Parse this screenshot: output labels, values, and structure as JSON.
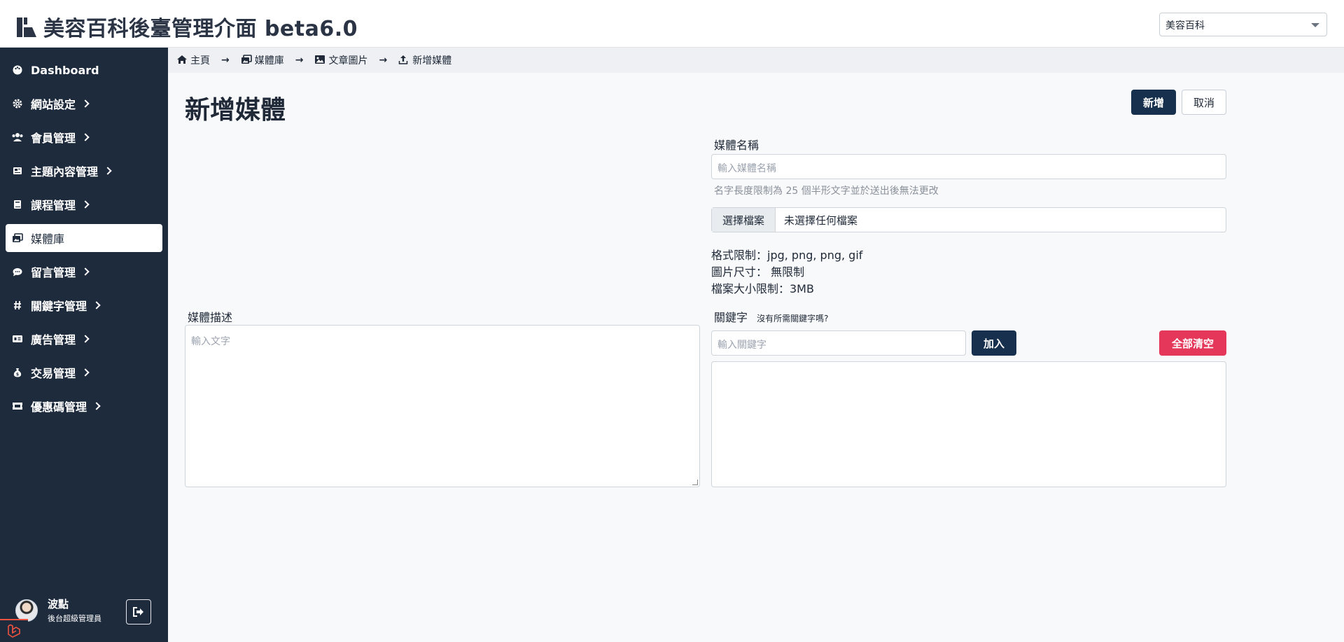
{
  "header": {
    "title": "美容百科後臺管理介面 beta6.0",
    "site_select_value": "美容百科"
  },
  "sidebar": {
    "items": [
      {
        "label": "Dashboard",
        "icon": "palette-icon"
      },
      {
        "label": "網站設定",
        "icon": "gear-icon"
      },
      {
        "label": "會員管理",
        "icon": "users-icon"
      },
      {
        "label": "主題內容管理",
        "icon": "newspaper-icon"
      },
      {
        "label": "課程管理",
        "icon": "book-icon"
      },
      {
        "label": "媒體庫",
        "icon": "images-icon"
      },
      {
        "label": "留言管理",
        "icon": "comment-icon"
      },
      {
        "label": "關鍵字管理",
        "icon": "hashtag-icon"
      },
      {
        "label": "廣告管理",
        "icon": "ad-icon"
      },
      {
        "label": "交易管理",
        "icon": "money-bag-icon"
      },
      {
        "label": "優惠碼管理",
        "icon": "ticket-icon"
      }
    ],
    "user": {
      "name": "波點",
      "role": "後台超級管理員"
    }
  },
  "breadcrumb": [
    {
      "label": "主頁",
      "icon": "home-icon"
    },
    {
      "label": "媒體庫",
      "icon": "images-icon"
    },
    {
      "label": "文章圖片",
      "icon": "image-icon"
    },
    {
      "label": "新增媒體",
      "icon": "upload-icon"
    }
  ],
  "page": {
    "title": "新增媒體",
    "add_button": "新增",
    "cancel_button": "取消"
  },
  "form": {
    "name_label": "媒體名稱",
    "name_placeholder": "輸入媒體名稱",
    "name_hint": "名字長度限制為 25 個半形文字並於送出後無法更改",
    "file_button": "選擇檔案",
    "file_status": "未選擇任何檔案",
    "format_rule": "格式限制：jpg, png, png, gif",
    "size_rule": "圖片尺寸： 無限制",
    "filesize_rule": "檔案大小限制：3MB",
    "description_label": "媒體描述",
    "description_placeholder": "輸入文字",
    "keyword_label": "關鍵字",
    "keyword_help": "沒有所需關鍵字嗎?",
    "keyword_placeholder": "輸入關鍵字",
    "keyword_add": "加入",
    "keyword_clear": "全部清空"
  },
  "colors": {
    "sidebar": "#1e2b3d",
    "primary": "#17304e",
    "danger": "#e4375a"
  }
}
